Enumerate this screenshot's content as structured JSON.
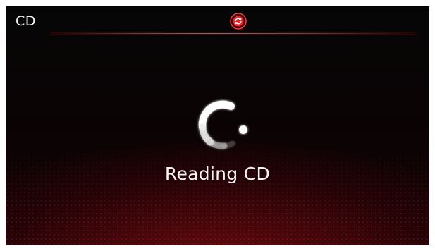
{
  "header": {
    "title": "CD",
    "status_icon": "cd-repeat-icon",
    "accent_color": "#e8262b"
  },
  "main": {
    "status_message": "Reading CD",
    "loading_icon": "loading-spinner-icon"
  }
}
